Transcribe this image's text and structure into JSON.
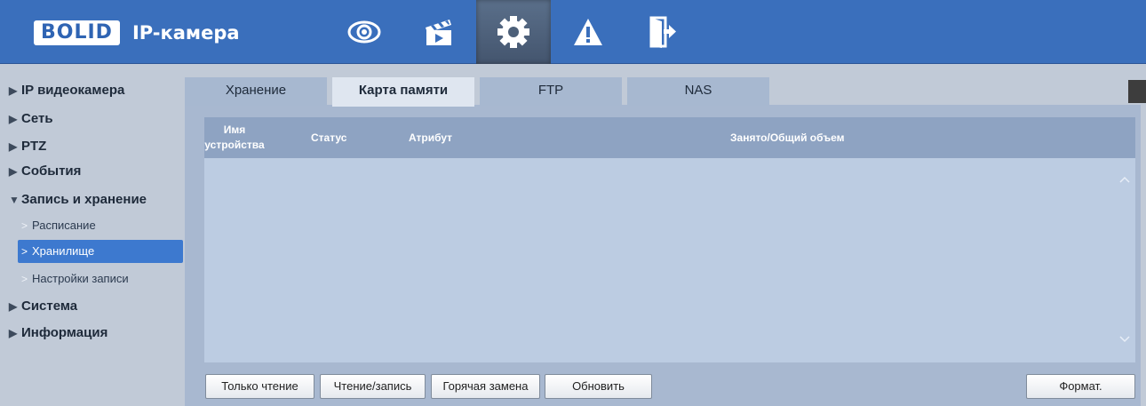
{
  "header": {
    "logo_mark": "BOLID",
    "logo_text": "IP-камера",
    "nav_icons": [
      "eye-icon",
      "clapperboard-icon",
      "gear-icon",
      "warning-icon",
      "exit-icon"
    ],
    "active_nav": "gear-icon"
  },
  "sidebar": {
    "items": [
      {
        "label": "IP видеокамера",
        "expanded": false
      },
      {
        "label": "Сеть",
        "expanded": false
      },
      {
        "label": "PTZ",
        "expanded": false
      },
      {
        "label": "События",
        "expanded": false
      },
      {
        "label": "Запись и хранение",
        "expanded": true
      },
      {
        "label": "Система",
        "expanded": false
      },
      {
        "label": "Информация",
        "expanded": false
      }
    ],
    "sub_items": [
      {
        "label": "Расписание",
        "active": false
      },
      {
        "label": "Хранилище",
        "active": true
      },
      {
        "label": "Настройки записи",
        "active": false
      }
    ]
  },
  "tabs": [
    {
      "label": "Хранение",
      "active": false
    },
    {
      "label": "Карта памяти",
      "active": true
    },
    {
      "label": "FTP",
      "active": false
    },
    {
      "label": "NAS",
      "active": false
    }
  ],
  "table": {
    "columns": [
      "Имя устройства",
      "Статус",
      "Атрибут",
      "Занято/Общий объем"
    ],
    "rows": []
  },
  "buttons": {
    "read_only": "Только чтение",
    "read_write": "Чтение/запись",
    "hot_swap": "Горячая замена",
    "refresh": "Обновить",
    "format": "Формат."
  },
  "colors": {
    "header_bg": "#3a6fbc",
    "active_sidebar": "#3d79cf",
    "table_header": "#8ea3c2",
    "table_body": "#bccce2"
  }
}
